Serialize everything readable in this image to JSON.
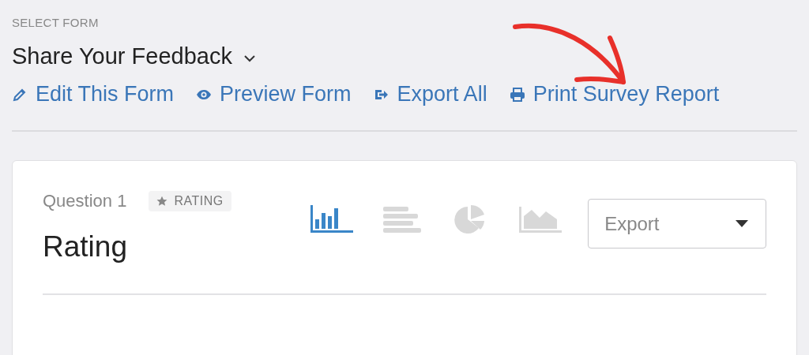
{
  "form_selector": {
    "label": "SELECT FORM",
    "title": "Share Your Feedback"
  },
  "actions": [
    {
      "kind": "edit",
      "label": "Edit This Form"
    },
    {
      "kind": "preview",
      "label": "Preview Form"
    },
    {
      "kind": "export",
      "label": "Export All"
    },
    {
      "kind": "print",
      "label": "Print Survey Report"
    }
  ],
  "question": {
    "number": "Question 1",
    "type_badge": "RATING",
    "title": "Rating",
    "chart_types": [
      {
        "kind": "bar",
        "selected": true
      },
      {
        "kind": "horizontal-bar",
        "selected": false
      },
      {
        "kind": "pie",
        "selected": false
      },
      {
        "kind": "area",
        "selected": false
      }
    ],
    "export": {
      "value": "Export"
    }
  }
}
